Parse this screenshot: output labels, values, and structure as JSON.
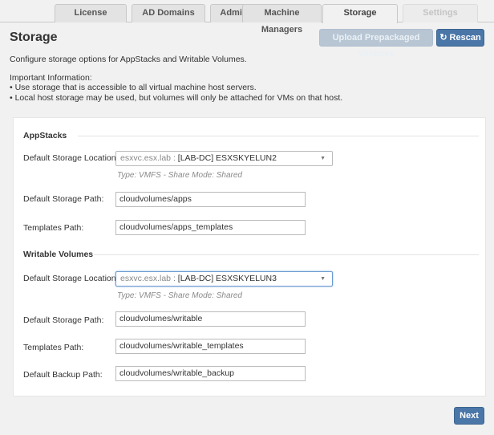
{
  "tabs": [
    {
      "label": "License"
    },
    {
      "label": "AD Domains"
    },
    {
      "label": "Admin Roles"
    },
    {
      "label": "Machine Managers"
    },
    {
      "label": "Storage"
    },
    {
      "label": "Settings"
    }
  ],
  "header": {
    "title": "Storage",
    "upload_label": "Upload Prepackaged Volumes",
    "rescan_label": "Rescan",
    "rescan_icon": "refresh-icon"
  },
  "intro": {
    "line1": "Configure storage options for AppStacks and Writable Volumes.",
    "important_title": "Important Information:",
    "bullet1": "• Use storage that is accessible to all virtual machine host servers.",
    "bullet2": "• Local host storage may be used, but volumes will only be attached for VMs on that host."
  },
  "appstacks": {
    "heading": "AppStacks",
    "location_label": "Default Storage Location:",
    "location_prefix": "esxvc.esx.lab :",
    "location_value": "[LAB-DC] ESXSKYELUN2",
    "location_hint": "Type: VMFS - Share Mode: Shared",
    "path_label": "Default Storage Path:",
    "path_value": "cloudvolumes/apps",
    "templates_label": "Templates Path:",
    "templates_value": "cloudvolumes/apps_templates"
  },
  "writable": {
    "heading": "Writable Volumes",
    "location_label": "Default Storage Location:",
    "location_prefix": "esxvc.esx.lab :",
    "location_value": "[LAB-DC] ESXSKYELUN3",
    "location_hint": "Type: VMFS - Share Mode: Shared",
    "path_label": "Default Storage Path:",
    "path_value": "cloudvolumes/writable",
    "templates_label": "Templates Path:",
    "templates_value": "cloudvolumes/writable_templates",
    "backup_label": "Default Backup Path:",
    "backup_value": "cloudvolumes/writable_backup"
  },
  "footer": {
    "next_label": "Next"
  },
  "colors": {
    "primary": "#4a76a8",
    "disabled_button": "#b8c6d4",
    "page_bg": "#f1f1f1"
  }
}
